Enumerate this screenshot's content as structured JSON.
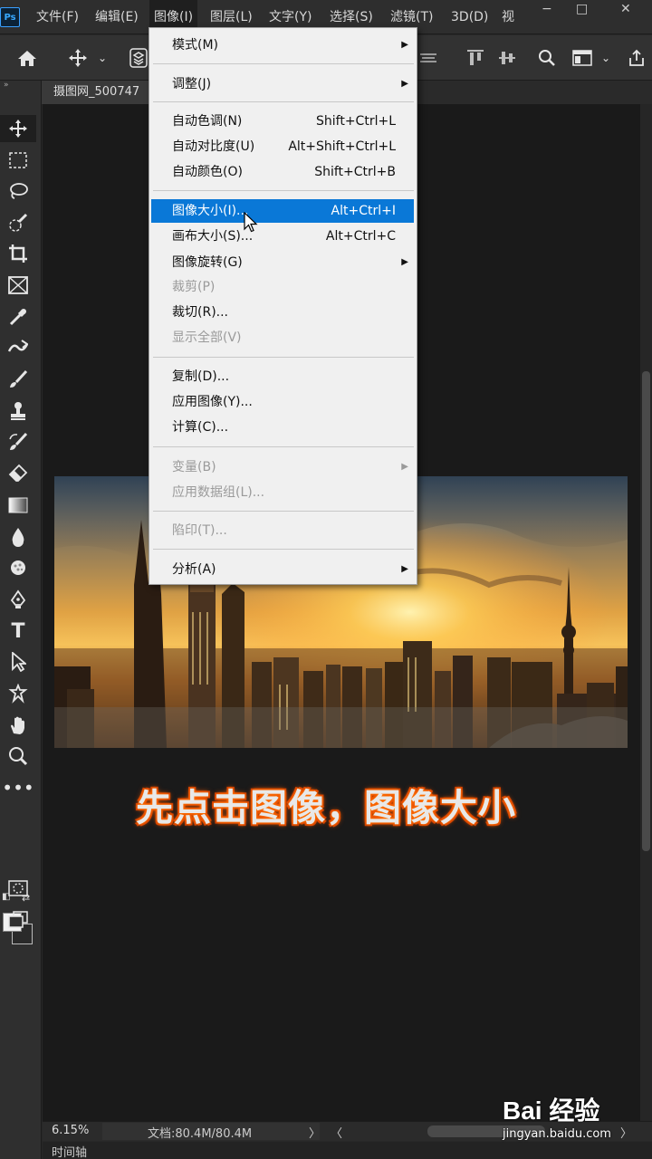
{
  "app": {
    "logo_text": "Ps"
  },
  "menubar": {
    "items": [
      "文件(F)",
      "编辑(E)",
      "图像(I)",
      "图层(L)",
      "文字(Y)",
      "选择(S)",
      "滤镜(T)",
      "3D(D)",
      "视"
    ],
    "window_buttons": [
      "−",
      "□",
      "✕"
    ]
  },
  "options_bar": {
    "icons": [
      "home-icon",
      "move-icon",
      "chevron-down-icon",
      "layers-icon",
      "distribute-icon",
      "align-top-icon",
      "align-vcenter-icon",
      "search-icon",
      "workspace-icon",
      "chevron-down-icon",
      "share-icon"
    ]
  },
  "document_tab": {
    "label": "摄图网_500747"
  },
  "toolbar": {
    "tools": [
      "move-tool",
      "marquee-tool",
      "lasso-tool",
      "quick-select-tool",
      "crop-tool",
      "frame-tool",
      "eyedropper-tool",
      "healing-tool",
      "brush-tool",
      "stamp-tool",
      "history-brush-tool",
      "eraser-tool",
      "gradient-tool",
      "blur-tool",
      "dodge-tool",
      "pen-tool",
      "type-tool",
      "path-select-tool",
      "shape-tool",
      "hand-tool",
      "zoom-tool",
      "more-tools",
      "swap-colors",
      "quick-mask",
      "screen-mode"
    ],
    "foreground_color": "#f2f2f2",
    "background_color": "#2a2a2a"
  },
  "image_menu": {
    "items": [
      {
        "label": "模式(M)",
        "shortcut": "",
        "submenu": true,
        "enabled": true
      },
      {
        "label": "调整(J)",
        "shortcut": "",
        "submenu": true,
        "enabled": true
      },
      {
        "label": "自动色调(N)",
        "shortcut": "Shift+Ctrl+L",
        "submenu": false,
        "enabled": true
      },
      {
        "label": "自动对比度(U)",
        "shortcut": "Alt+Shift+Ctrl+L",
        "submenu": false,
        "enabled": true
      },
      {
        "label": "自动颜色(O)",
        "shortcut": "Shift+Ctrl+B",
        "submenu": false,
        "enabled": true
      },
      {
        "label": "图像大小(I)...",
        "shortcut": "Alt+Ctrl+I",
        "submenu": false,
        "enabled": true,
        "highlighted": true
      },
      {
        "label": "画布大小(S)...",
        "shortcut": "Alt+Ctrl+C",
        "submenu": false,
        "enabled": true
      },
      {
        "label": "图像旋转(G)",
        "shortcut": "",
        "submenu": true,
        "enabled": true
      },
      {
        "label": "裁剪(P)",
        "shortcut": "",
        "submenu": false,
        "enabled": false
      },
      {
        "label": "裁切(R)...",
        "shortcut": "",
        "submenu": false,
        "enabled": true
      },
      {
        "label": "显示全部(V)",
        "shortcut": "",
        "submenu": false,
        "enabled": false
      },
      {
        "label": "复制(D)...",
        "shortcut": "",
        "submenu": false,
        "enabled": true
      },
      {
        "label": "应用图像(Y)...",
        "shortcut": "",
        "submenu": false,
        "enabled": true
      },
      {
        "label": "计算(C)...",
        "shortcut": "",
        "submenu": false,
        "enabled": true
      },
      {
        "label": "变量(B)",
        "shortcut": "",
        "submenu": true,
        "enabled": false
      },
      {
        "label": "应用数据组(L)...",
        "shortcut": "",
        "submenu": false,
        "enabled": false
      },
      {
        "label": "陷印(T)...",
        "shortcut": "",
        "submenu": false,
        "enabled": false
      },
      {
        "label": "分析(A)",
        "shortcut": "",
        "submenu": true,
        "enabled": true
      }
    ],
    "submenu_arrow": "▶"
  },
  "caption": "先点击图像，图像大小",
  "status": {
    "zoom": "6.15%",
    "doc_info": "文档:80.4M/80.4M",
    "arrow_right": "〉",
    "arrow_left": "〈",
    "arrow_right2": "〉"
  },
  "timeline": {
    "label": "时间轴"
  },
  "watermark": {
    "logo": "Bai 经验",
    "url": "jingyan.baidu.com"
  },
  "colors": {
    "highlight": "#0a78d7",
    "menu_bg": "#f0f0f0",
    "canvas_bg": "#1a1a1a",
    "caption_glow": "#ff6a00"
  }
}
